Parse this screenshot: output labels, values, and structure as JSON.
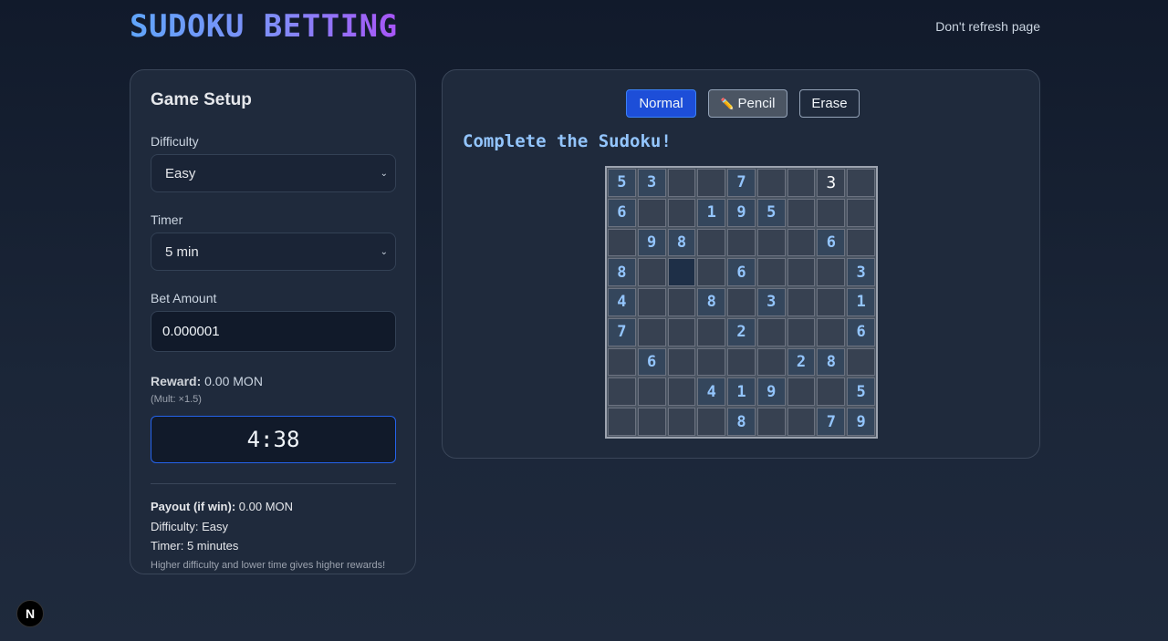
{
  "header": {
    "title": "SUDOKU BETTING",
    "notice": "Don't refresh page"
  },
  "setup": {
    "title": "Game Setup",
    "difficulty_label": "Difficulty",
    "difficulty_value": "Easy",
    "timer_label": "Timer",
    "timer_value": "5 min",
    "bet_label": "Bet Amount",
    "bet_value": "0.000001",
    "reward_label": "Reward:",
    "reward_value": "0.00 MON",
    "multiplier": "(Mult: ×1.5)",
    "countdown": "4:38",
    "payout_label": "Payout (if win):",
    "payout_value": "0.00 MON",
    "difficulty_info": "Difficulty: Easy",
    "timer_info": "Timer: 5 minutes",
    "hint": "Higher difficulty and lower time gives higher rewards!"
  },
  "board": {
    "modes": {
      "normal": "Normal",
      "pencil": "Pencil",
      "erase": "Erase"
    },
    "heading": "Complete the Sudoku!",
    "cells": [
      [
        "5g",
        "3g",
        "",
        "",
        "7g",
        "",
        "",
        "3e",
        ""
      ],
      [
        "6g",
        "",
        "",
        "1g",
        "9g",
        "5g",
        "",
        "",
        ""
      ],
      [
        "",
        "9g",
        "8g",
        "",
        "",
        "",
        "",
        "6g",
        ""
      ],
      [
        "8g",
        "",
        "s",
        "",
        "6g",
        "",
        "",
        "",
        "3g"
      ],
      [
        "4g",
        "",
        "",
        "8g",
        "",
        "3g",
        "",
        "",
        "1g"
      ],
      [
        "7g",
        "",
        "",
        "",
        "2g",
        "",
        "",
        "",
        "6g"
      ],
      [
        "",
        "6g",
        "",
        "",
        "",
        "",
        "2g",
        "8g",
        ""
      ],
      [
        "",
        "",
        "",
        "4g",
        "1g",
        "9g",
        "",
        "",
        "5g"
      ],
      [
        "",
        "",
        "",
        "",
        "8g",
        "",
        "",
        "7g",
        "9g"
      ]
    ]
  },
  "icons": {
    "pencil": "pencil-icon",
    "chevron": "chevron-down-icon",
    "badge": "N"
  }
}
